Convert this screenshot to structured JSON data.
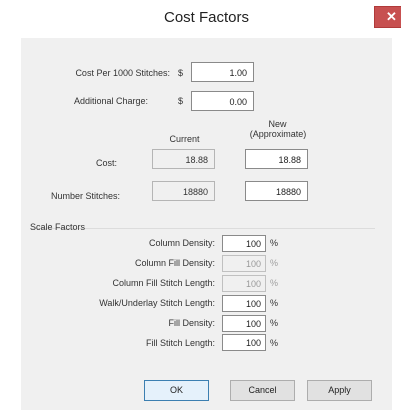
{
  "window": {
    "title": "Cost Factors",
    "close_glyph": "✕"
  },
  "cost": {
    "per1000_label": "Cost Per 1000 Stitches:",
    "per1000_currency": "$",
    "per1000_value": "1.00",
    "additional_label": "Additional Charge:",
    "additional_currency": "$",
    "additional_value": "0.00"
  },
  "table": {
    "current_header": "Current",
    "new_header_line1": "New",
    "new_header_line2": "(Approximate)",
    "cost_label": "Cost:",
    "cost_current": "18.88",
    "cost_new": "18.88",
    "stitches_label": "Number Stitches:",
    "stitches_current": "18880",
    "stitches_new": "18880"
  },
  "scale": {
    "group_label": "Scale Factors",
    "percent_symbol": "%",
    "rows": [
      {
        "label": "Column Density:",
        "value": "100",
        "enabled": true
      },
      {
        "label": "Column Fill Density:",
        "value": "100",
        "enabled": false
      },
      {
        "label": "Column Fill Stitch Length:",
        "value": "100",
        "enabled": false
      },
      {
        "label": "Walk/Underlay Stitch Length:",
        "value": "100",
        "enabled": true
      },
      {
        "label": "Fill Density:",
        "value": "100",
        "enabled": true
      },
      {
        "label": "Fill Stitch Length:",
        "value": "100",
        "enabled": true
      }
    ]
  },
  "buttons": {
    "ok": "OK",
    "cancel": "Cancel",
    "apply": "Apply"
  },
  "colors": {
    "dialog_bg": "#f0f0f0",
    "close_button": "#c75050",
    "default_button_border": "#3c7fb1"
  }
}
